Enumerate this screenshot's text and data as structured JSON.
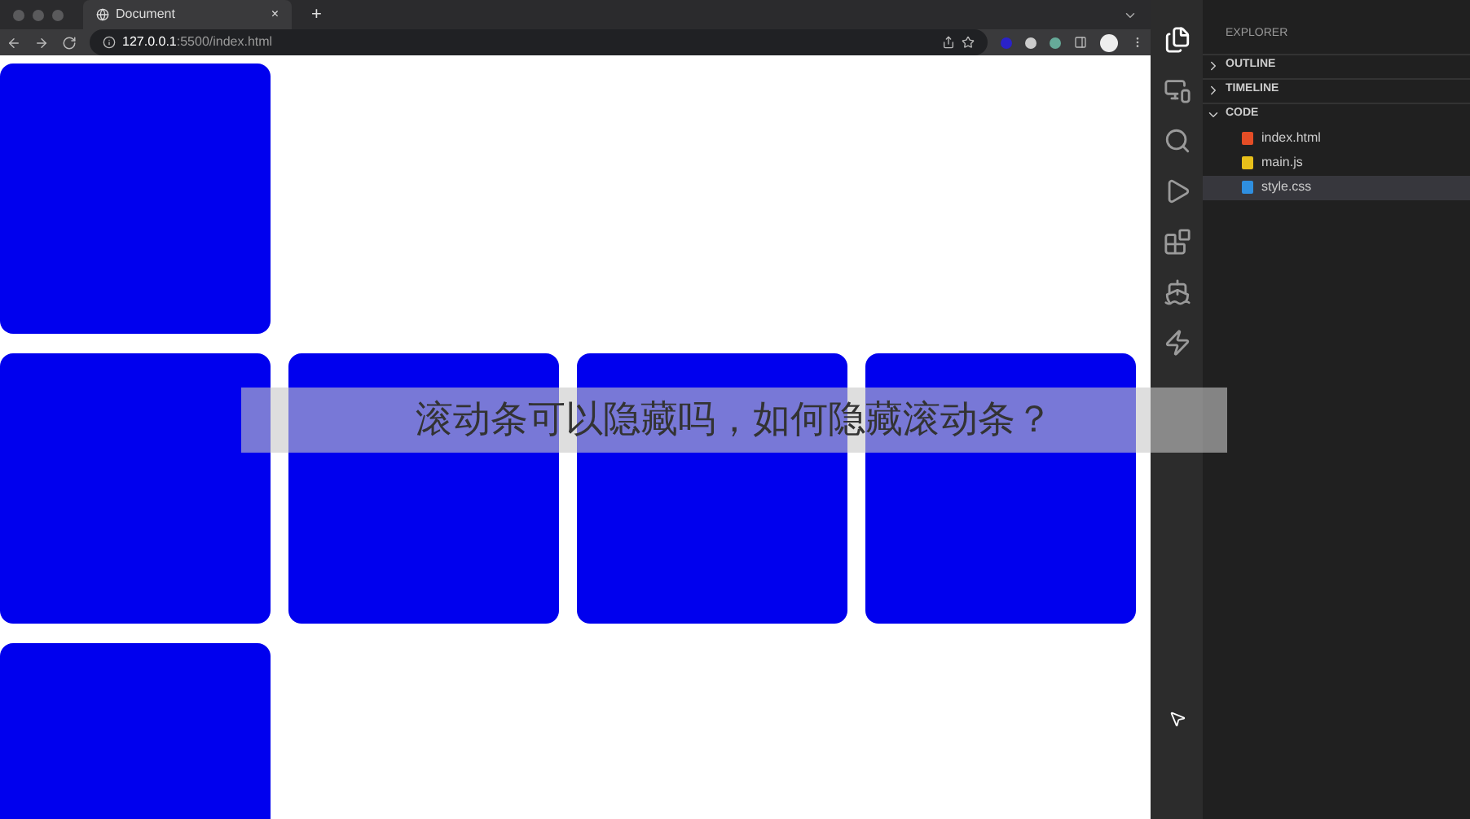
{
  "browser": {
    "tab": {
      "title": "Document",
      "close": "×"
    },
    "new_tab": "+",
    "address": {
      "host": "127.0.0.1",
      "path": ":5500/index.html"
    }
  },
  "explorer": {
    "title": "EXPLORER",
    "sections": [
      {
        "label": "OUTLINE",
        "expanded": false
      },
      {
        "label": "TIMELINE",
        "expanded": false
      },
      {
        "label": "CODE",
        "expanded": true,
        "files": [
          {
            "name": "index.html",
            "kind": "html",
            "selected": false
          },
          {
            "name": "main.js",
            "kind": "js",
            "selected": false
          },
          {
            "name": "style.css",
            "kind": "css",
            "selected": true
          }
        ]
      }
    ]
  },
  "caption": "滚动条可以隐藏吗，如何隐藏滚动条？"
}
